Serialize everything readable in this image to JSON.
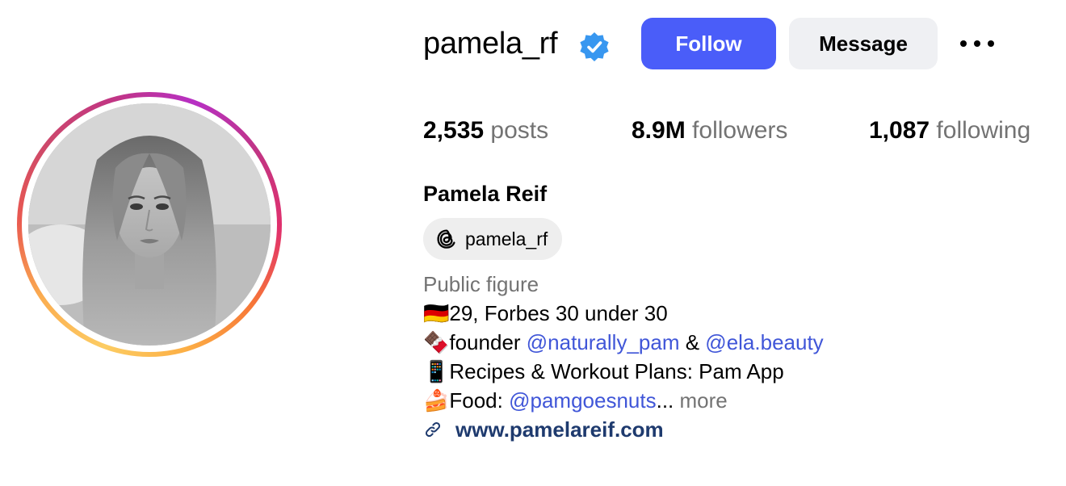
{
  "profile": {
    "username": "pamela_rf",
    "verified": true,
    "full_name": "Pamela Reif",
    "threads_handle": "pamela_rf",
    "category": "Public figure",
    "website": "www.pamelareif.com"
  },
  "actions": {
    "follow_label": "Follow",
    "message_label": "Message",
    "more_icon": "more-options-icon"
  },
  "stats": {
    "posts_count": "2,535",
    "posts_label": "posts",
    "followers_count": "8.9M",
    "followers_label": "followers",
    "following_count": "1,087",
    "following_label": "following"
  },
  "bio": {
    "line1_emoji": "🇩🇪",
    "line1_text": "29, Forbes 30 under 30",
    "line2_emoji": "🍫",
    "line2_text": "founder ",
    "line2_mention1": "@naturally_pam",
    "line2_sep": " & ",
    "line2_mention2": "@ela.beauty",
    "line3_emoji": "📱",
    "line3_text": "Recipes & Workout Plans: Pam App",
    "line4_emoji": "🍰",
    "line4_text": "Food: ",
    "line4_mention": "@pamgoesnuts",
    "line4_ellipsis": "...",
    "more_label": "more"
  },
  "colors": {
    "follow_bg": "#4a5df9",
    "message_bg": "#eff0f3",
    "mention": "#4056d8",
    "website": "#1e3a6e",
    "muted": "#737373",
    "verified": "#3897f0"
  }
}
